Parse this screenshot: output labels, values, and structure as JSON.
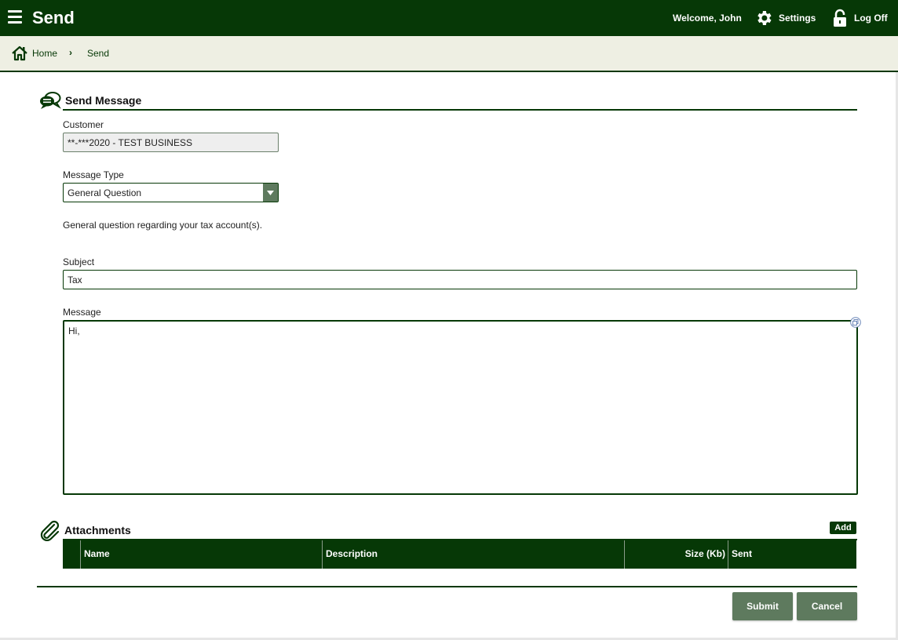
{
  "header": {
    "title": "Send",
    "welcome": "Welcome, John",
    "settings_label": "Settings",
    "logoff_label": "Log Off",
    "menu_icon": "hamburger-icon",
    "settings_icon": "gear-icon",
    "logoff_icon": "lock-icon"
  },
  "breadcrumb": {
    "home_icon": "home-icon",
    "home": "Home",
    "separator": "›",
    "current": "Send"
  },
  "send_message": {
    "icon": "chat-bubbles-icon",
    "title": "Send Message",
    "customer_label": "Customer",
    "customer_value": "**-***2020 - TEST BUSINESS",
    "message_type_label": "Message Type",
    "message_type_value": "General Question",
    "message_type_description": "General question regarding your tax account(s).",
    "subject_label": "Subject",
    "subject_value": "Tax",
    "message_label": "Message",
    "message_value": "Hi,"
  },
  "attachments": {
    "icon": "paperclip-icon",
    "title": "Attachments",
    "add_label": "Add",
    "columns": [
      "Name",
      "Description",
      "Size (Kb)",
      "Sent"
    ]
  },
  "actions": {
    "submit_label": "Submit",
    "cancel_label": "Cancel"
  },
  "colors": {
    "primary": "#063806",
    "button": "#5e7a5e",
    "breadcrumb_bg": "#eeefe3"
  }
}
